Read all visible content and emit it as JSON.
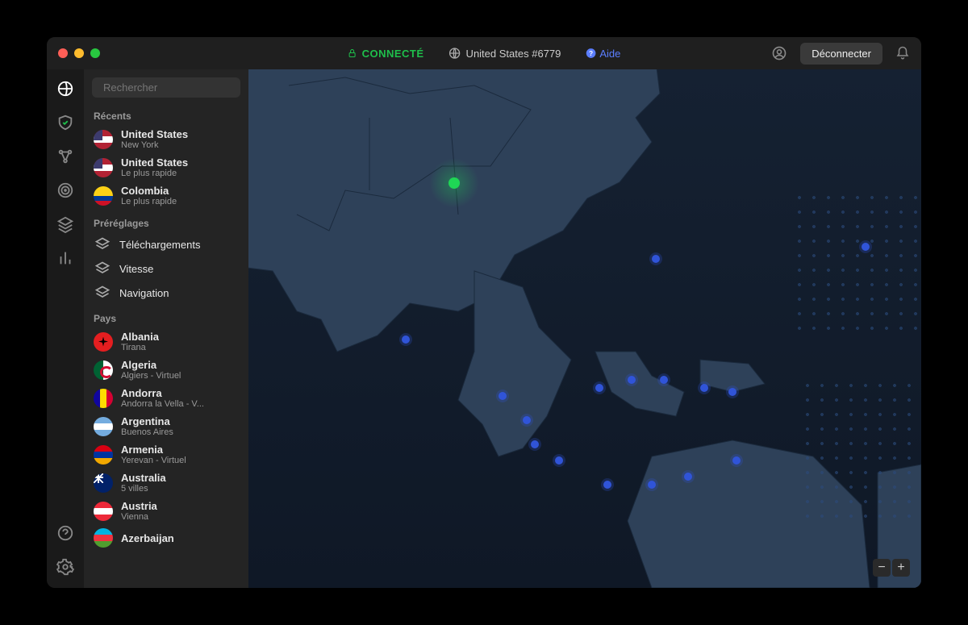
{
  "titlebar": {
    "status_label": "CONNECTÉ",
    "server_label": "United States #6779",
    "help_label": "Aide",
    "disconnect_label": "Déconnecter"
  },
  "search": {
    "placeholder": "Rechercher"
  },
  "sections": {
    "recents_label": "Récents",
    "presets_label": "Préréglages",
    "countries_label": "Pays"
  },
  "recents": [
    {
      "title": "United States",
      "sub": "New York",
      "flag": "fl-us"
    },
    {
      "title": "United States",
      "sub": "Le plus rapide",
      "flag": "fl-us"
    },
    {
      "title": "Colombia",
      "sub": "Le plus rapide",
      "flag": "fl-co"
    }
  ],
  "presets": [
    {
      "title": "Téléchargements"
    },
    {
      "title": "Vitesse"
    },
    {
      "title": "Navigation"
    }
  ],
  "countries": [
    {
      "title": "Albania",
      "sub": "Tirana",
      "flag": "fl-al"
    },
    {
      "title": "Algeria",
      "sub": "Algiers - Virtuel",
      "flag": "fl-dz"
    },
    {
      "title": "Andorra",
      "sub": "Andorra la Vella - V...",
      "flag": "fl-ad"
    },
    {
      "title": "Argentina",
      "sub": "Buenos Aires",
      "flag": "fl-ar"
    },
    {
      "title": "Armenia",
      "sub": "Yerevan - Virtuel",
      "flag": "fl-am"
    },
    {
      "title": "Australia",
      "sub": "5 villes",
      "flag": "fl-au"
    },
    {
      "title": "Austria",
      "sub": "Vienna",
      "flag": "fl-at"
    },
    {
      "title": "Azerbaijan",
      "sub": "",
      "flag": "fl-az"
    }
  ],
  "zoom": {
    "out": "−",
    "in": "+"
  }
}
